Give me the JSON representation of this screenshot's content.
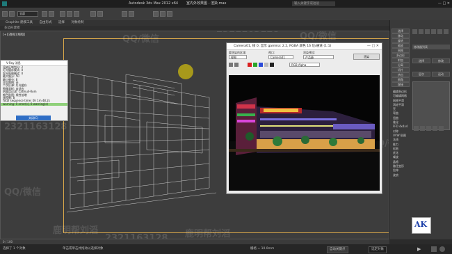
{
  "titlebar": {
    "app_title": "Autodesk 3ds Max 2012 x64",
    "file_title": "室内外效果图 - 渲染.max",
    "search_placeholder": "输入关键字或短语"
  },
  "ribbon": {
    "tabs": [
      "Graphite 建模工具",
      "自由形式",
      "选择",
      "对象绘制"
    ],
    "sub_label": "多边形建模"
  },
  "viewport": {
    "label": "[+][透视][线框]",
    "watermarks": [
      "QQ/微信",
      "QQ/微信",
      "QQ/微信",
      "QQ/微信",
      "鹿明帮刘滔",
      "鹿明帮刘滔",
      "2321163128",
      "2321163128",
      "2321163128",
      "1631128"
    ]
  },
  "vray_window": {
    "title": "V-Ray 消息",
    "lines": [
      "渲染区域划分: 2",
      "灯光缓存模式: 0",
      "发光贴图模式: 0",
      "最大细分: 50",
      "最小细分: 8",
      "全局照明: 开",
      "二次反弹: 灯光缓存",
      "图像采样: 自适应",
      "抗锯齿过滤: Catmull-Rom",
      "颜色贴图: 线性倍增",
      "线程数: 8",
      "Total sequence time: 0h 1m 48.2s"
    ],
    "selected_line": "warning: 0 error(s), 0 warning(s)",
    "button_label": "关闭(C)"
  },
  "frame_buffer": {
    "title": "Camera01, 帧 0, 显示 gamma: 2.2, RGBA 颜色 16 位/通道 (1:1)",
    "controls": "—  □  ✕",
    "viewport_label": "要渲染的区域:",
    "viewport_value": "视图",
    "preset_label": "视口:",
    "preset_value": "Camera01",
    "render_preset_label": "渲染预设:",
    "render_preset_value": "产品级",
    "channel_value": "RGB Alpha",
    "render_button": "渲染"
  },
  "command_panel": {
    "top_buttons": [
      "选择",
      "移动",
      "旋转",
      "缩放",
      "网格",
      "多边形",
      "附加",
      "分离",
      "切片",
      "挤出",
      "倒角",
      "焊接"
    ],
    "rollout_label": "修改器列表",
    "list_items": [
      "编辑多边形",
      "可编辑网格",
      "网格平滑",
      "涡轮平滑",
      "壳",
      "弯曲",
      "扭曲",
      "锥化",
      "FFD 4x4x4",
      "对称",
      "UVW 贴图",
      "法线",
      "推力",
      "松弛",
      "优化",
      "噪波",
      "晶格",
      "路径变形",
      "拉伸",
      "波浪"
    ],
    "right_buttons": [
      "选择",
      "修改",
      "层次",
      "运动",
      "显示",
      "工具",
      "挤出",
      "倒角",
      "轮廓",
      "插入",
      "桥",
      "翻转"
    ]
  },
  "timeline": {
    "frame_label": "0 / 100"
  },
  "status_bar": {
    "text": "单击或单击并拖动以选择对象",
    "selection": "选择了 1 个对象",
    "grid": "栅格 = 10.0mm",
    "key_label": "自动关键点",
    "filter_value": "选定对象"
  },
  "logo": {
    "text": "AK"
  },
  "colors": {
    "wire": "#e6e6e6",
    "viewport_bg": "#3d3d3d",
    "frame_border": "#d9a74a",
    "selection_green": "#8fd07a",
    "accent_blue": "#2f6ec5"
  }
}
